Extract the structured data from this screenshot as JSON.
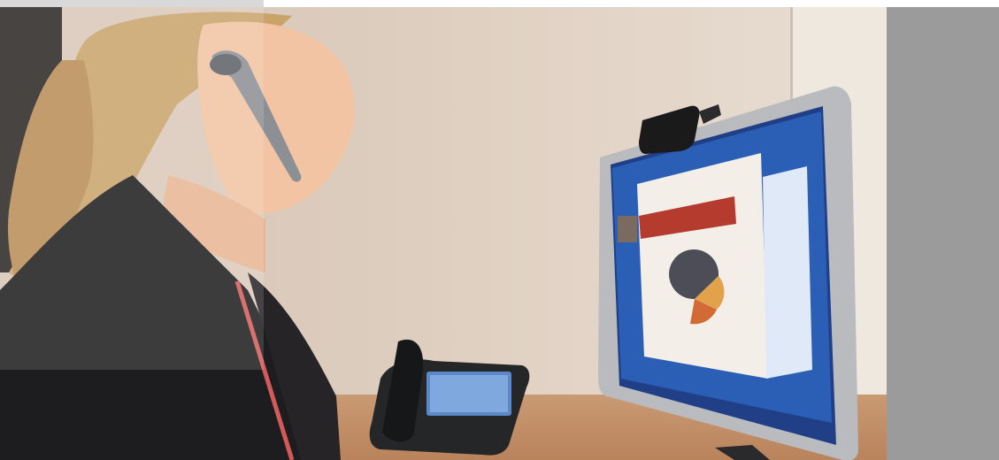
{
  "scene": {
    "subject": "woman-with-headset",
    "objects": [
      "bluetooth-headset-icon",
      "desk-phone-icon",
      "monitor",
      "webcam-icon",
      "pie-chart-on-screen"
    ]
  },
  "colors": {
    "right_panel": "#9b9b9b",
    "wall": "#dccbbd",
    "desk": "#c08e66",
    "jacket": "#1d1c1e",
    "screen_blue": "#2a5fb5"
  }
}
